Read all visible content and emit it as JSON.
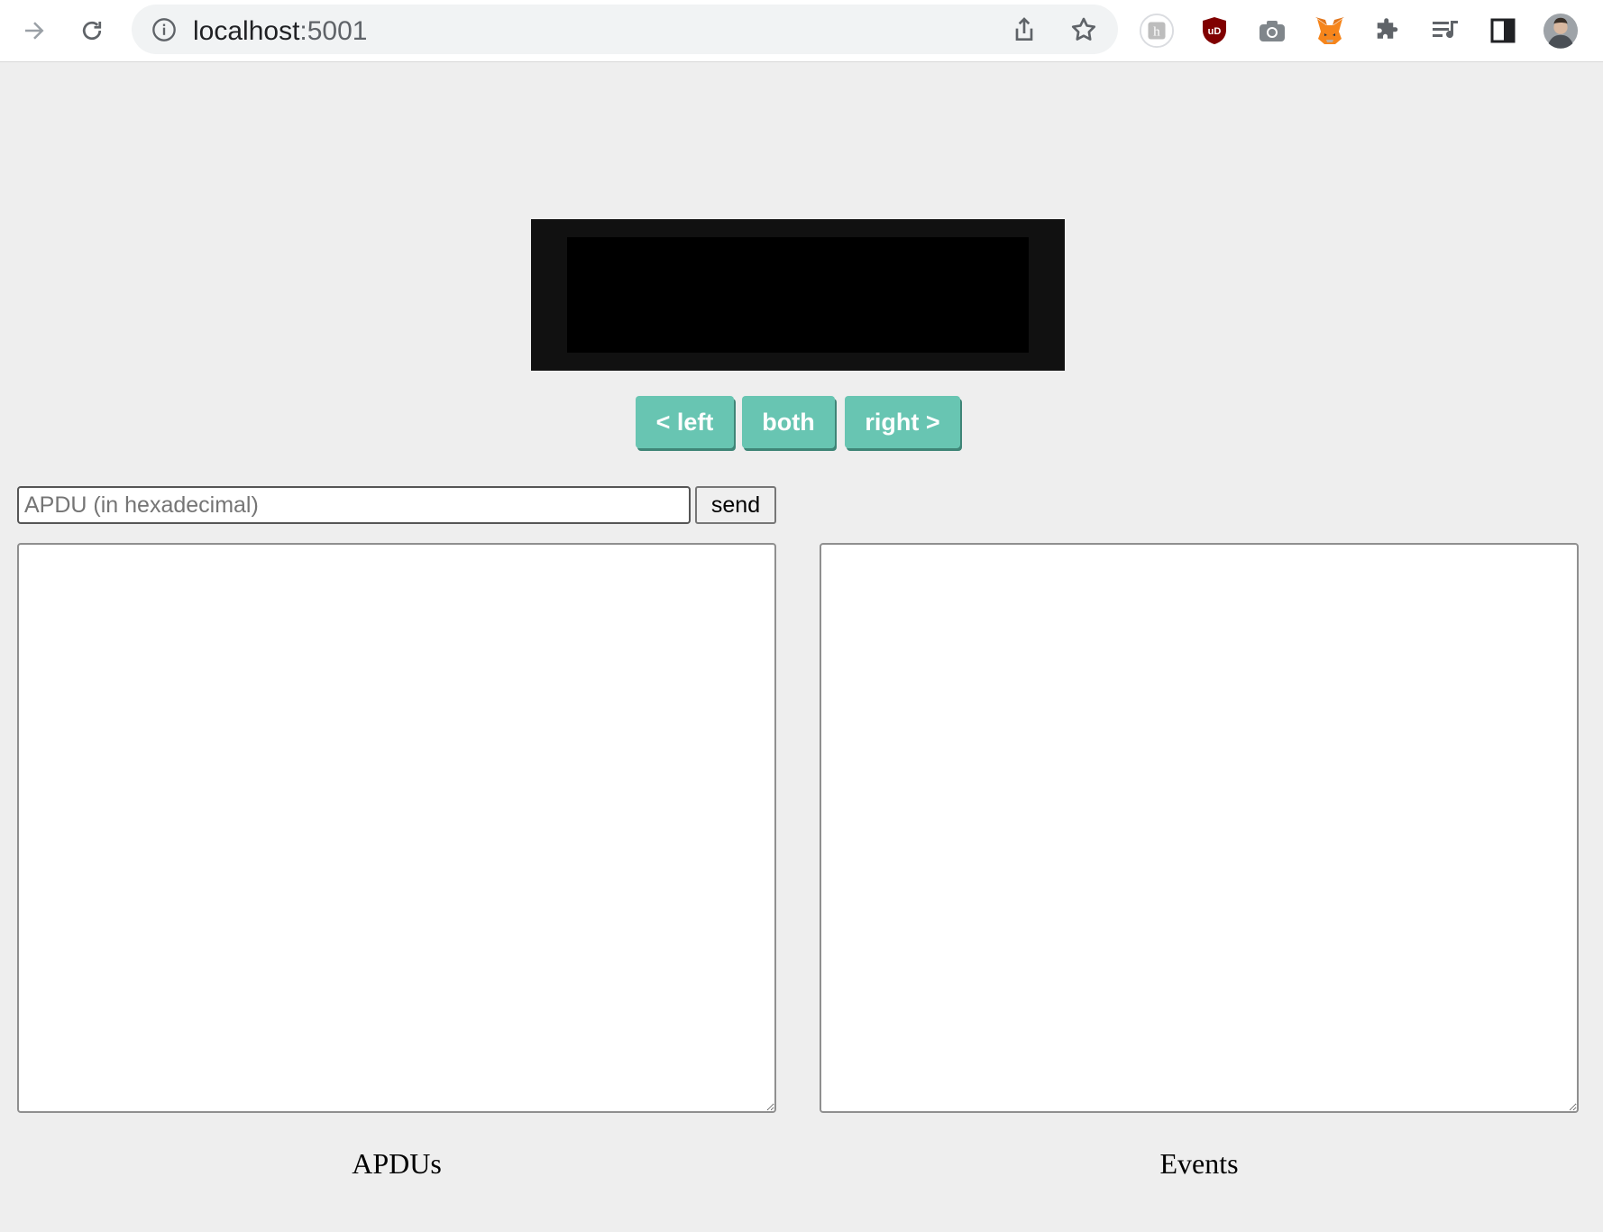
{
  "browser": {
    "url_host": "localhost",
    "url_port": ":5001",
    "icons": {
      "back": "forward-arrow-icon",
      "reload": "reload-icon",
      "info": "info-icon",
      "share": "share-icon",
      "bookmark": "star-icon",
      "extensions": [
        "hypothesis-extension-icon",
        "ublock-origin-icon",
        "camera-extension-icon",
        "metamask-fox-icon",
        "puzzle-extensions-icon",
        "media-queue-icon",
        "side-panel-icon",
        "profile-avatar"
      ]
    },
    "ublock_label": "uD",
    "hypothesis_label": "h"
  },
  "device": {
    "buttons": {
      "left": "< left",
      "both": "both",
      "right": "right >"
    }
  },
  "apdu": {
    "placeholder": "APDU (in hexadecimal)",
    "value": "",
    "send_label": "send"
  },
  "logs": {
    "apdus_label": "APDUs",
    "events_label": "Events",
    "apdus_content": "",
    "events_content": ""
  },
  "colors": {
    "button_bg": "#68c5b2",
    "screen_frame": "#111111",
    "screen": "#000000",
    "page_bg": "#eeeeee"
  }
}
